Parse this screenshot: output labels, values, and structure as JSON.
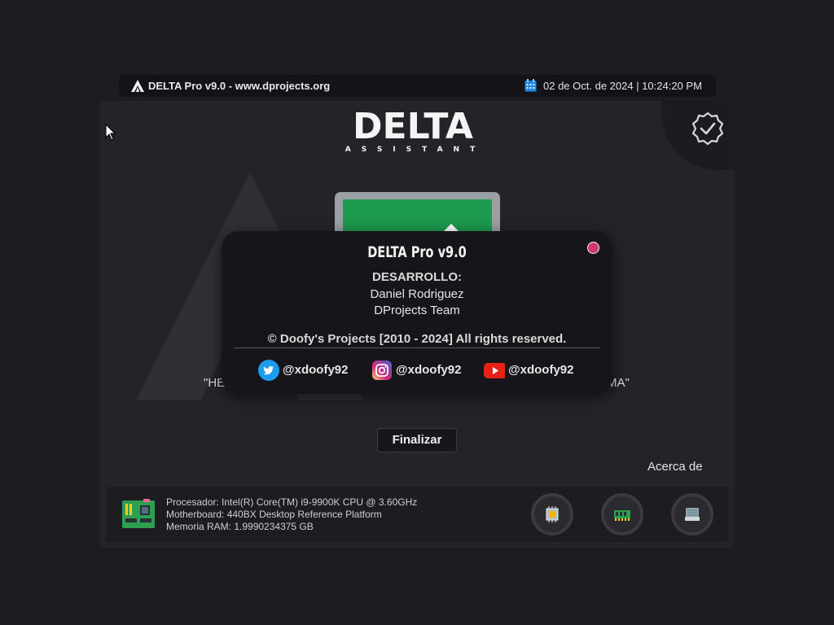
{
  "topbar": {
    "title": "DELTA Pro v9.0 - www.dprojects.org",
    "datetime": "02 de Oct. de 2024 | 10:24:20 PM",
    "logo_icon": "delta-logo-icon",
    "calendar_icon": "calendar-icon"
  },
  "brand": {
    "name": "DELTA",
    "tagline": "ASSISTANT"
  },
  "main": {
    "quote_left": "\"HE",
    "quote_right": "MA\"",
    "finish_label": "Finalizar",
    "about_label": "Acerca de",
    "status_icon": "badge-check-icon"
  },
  "system": {
    "cpu": "Procesador: Intel(R) Core(TM) i9-9900K CPU @ 3.60GHz",
    "motherboard": "Motherboard: 440BX Desktop Reference Platform",
    "ram": "Memoria RAM: 1.9990234375 GB",
    "buttons": [
      "cpu-icon",
      "ram-icon",
      "disk-icon"
    ]
  },
  "dialog": {
    "title": "DELTA Pro v9.0",
    "dev_heading": "DESARROLLO:",
    "dev_name": "Daniel Rodriguez",
    "dev_team": "DProjects Team",
    "copyright": "© Doofy's Projects [2010 - 2024]  All rights reserved.",
    "socials": [
      {
        "network": "twitter",
        "handle": "@xdoofy92"
      },
      {
        "network": "instagram",
        "handle": "@xdoofy92"
      },
      {
        "network": "youtube",
        "handle": "@xdoofy92"
      }
    ]
  },
  "colors": {
    "background": "#1c1c21",
    "panel": "#232329",
    "dialog": "#16161a",
    "close_dot": "#d0396c",
    "screen_green": "#1d9a4f"
  }
}
